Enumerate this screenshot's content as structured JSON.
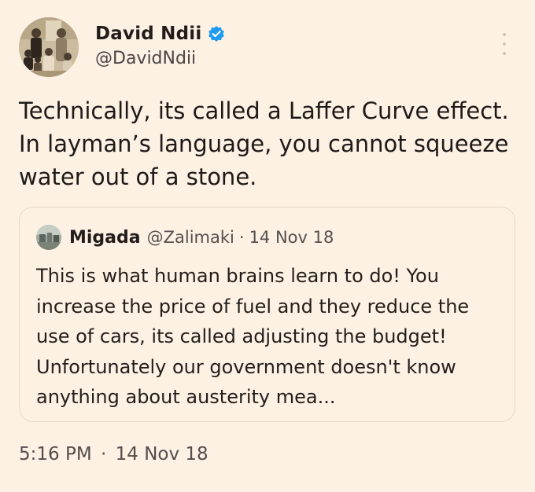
{
  "author": {
    "display_name": "David Ndii",
    "handle": "@DavidNdii",
    "verified": true,
    "avatar_icon": "vintage-family-photo"
  },
  "tweet": {
    "text": "Technically, its called a Laffer Curve effect.  In layman’s language, you cannot squeeze water out of a stone."
  },
  "quoted": {
    "display_name": "Migada",
    "handle": "@Zalimaki",
    "separator": "·",
    "date": "14 Nov 18",
    "text": "This is what human brains learn to do! You increase the price of fuel and they reduce the use of cars, its called adjusting the budget! Unfortunately our government doesn't know anything about austerity mea..."
  },
  "footer": {
    "time": "5:16 PM",
    "separator": "·",
    "date": "14 Nov 18"
  },
  "colors": {
    "background": "#fdf1e4",
    "verified_blue": "#1d9bf0"
  }
}
